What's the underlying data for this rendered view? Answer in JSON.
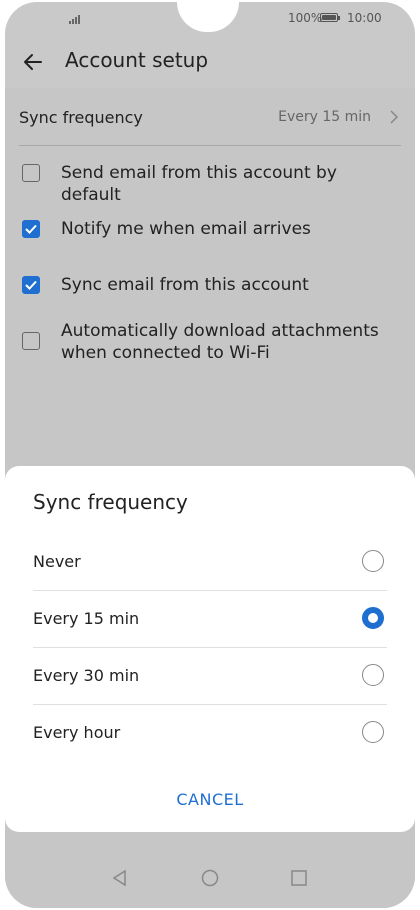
{
  "status_bar": {
    "battery_text": "100%",
    "time": "10:00"
  },
  "header": {
    "title": "Account setup"
  },
  "settings": {
    "sync_frequency_label": "Sync frequency",
    "sync_frequency_value": "Every 15 min",
    "options": [
      {
        "label": "Send email from this account by default",
        "checked": false
      },
      {
        "label": "Notify me when email arrives",
        "checked": true
      },
      {
        "label": "Sync email from this account",
        "checked": true
      },
      {
        "label": "Automatically download attachments when connected to Wi-Fi",
        "checked": false
      }
    ]
  },
  "dialog": {
    "title": "Sync frequency",
    "choices": [
      {
        "label": "Never",
        "selected": false
      },
      {
        "label": "Every 15 min",
        "selected": true
      },
      {
        "label": "Every 30 min",
        "selected": false
      },
      {
        "label": "Every hour",
        "selected": false
      }
    ],
    "cancel_label": "CANCEL"
  },
  "colors": {
    "accent": "#1f6fd1",
    "scrim": "#c6c6c6"
  }
}
